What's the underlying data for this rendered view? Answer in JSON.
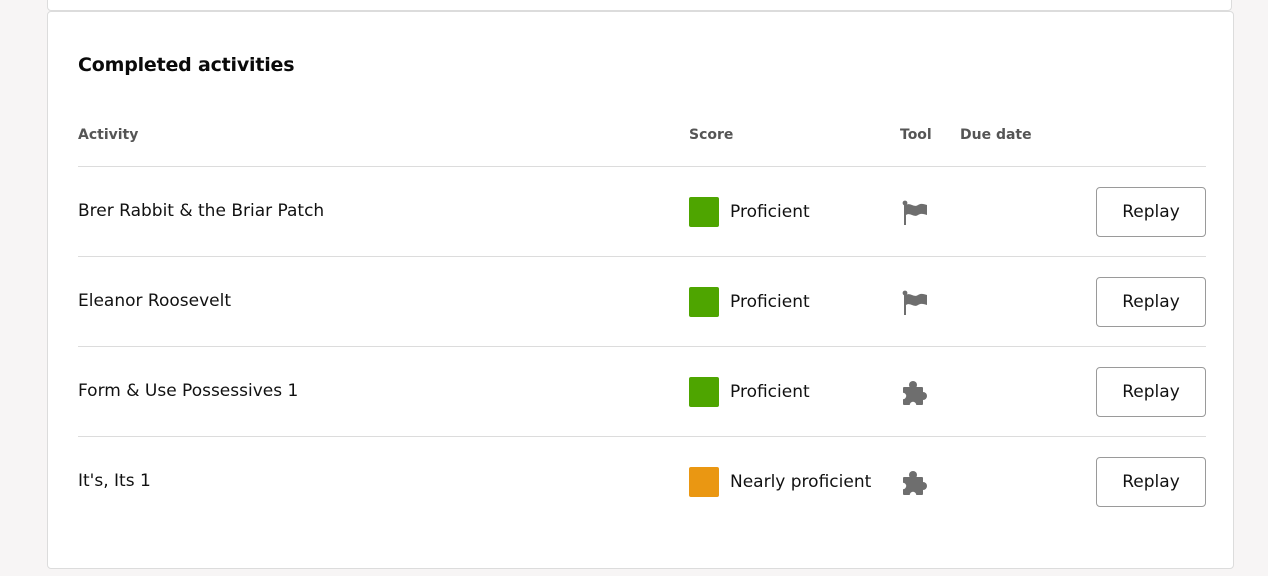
{
  "section": {
    "title": "Completed activities"
  },
  "columns": {
    "activity": "Activity",
    "score": "Score",
    "tool": "Tool",
    "due_date": "Due date"
  },
  "colors": {
    "proficient": "#4ea500",
    "nearly_proficient": "#ea9712",
    "tool_icon": "#6e6e6e"
  },
  "rows": [
    {
      "activity": "Brer Rabbit & the Briar Patch",
      "score_label": "Proficient",
      "score_level": "proficient",
      "tool_icon": "flag-icon",
      "due_date": "",
      "action_label": "Replay"
    },
    {
      "activity": "Eleanor Roosevelt",
      "score_label": "Proficient",
      "score_level": "proficient",
      "tool_icon": "flag-icon",
      "due_date": "",
      "action_label": "Replay"
    },
    {
      "activity": "Form & Use Possessives 1",
      "score_label": "Proficient",
      "score_level": "proficient",
      "tool_icon": "puzzle-icon",
      "due_date": "",
      "action_label": "Replay"
    },
    {
      "activity": "It's, Its 1",
      "score_label": "Nearly proficient",
      "score_level": "nearly_proficient",
      "tool_icon": "puzzle-icon",
      "due_date": "",
      "action_label": "Replay"
    }
  ]
}
